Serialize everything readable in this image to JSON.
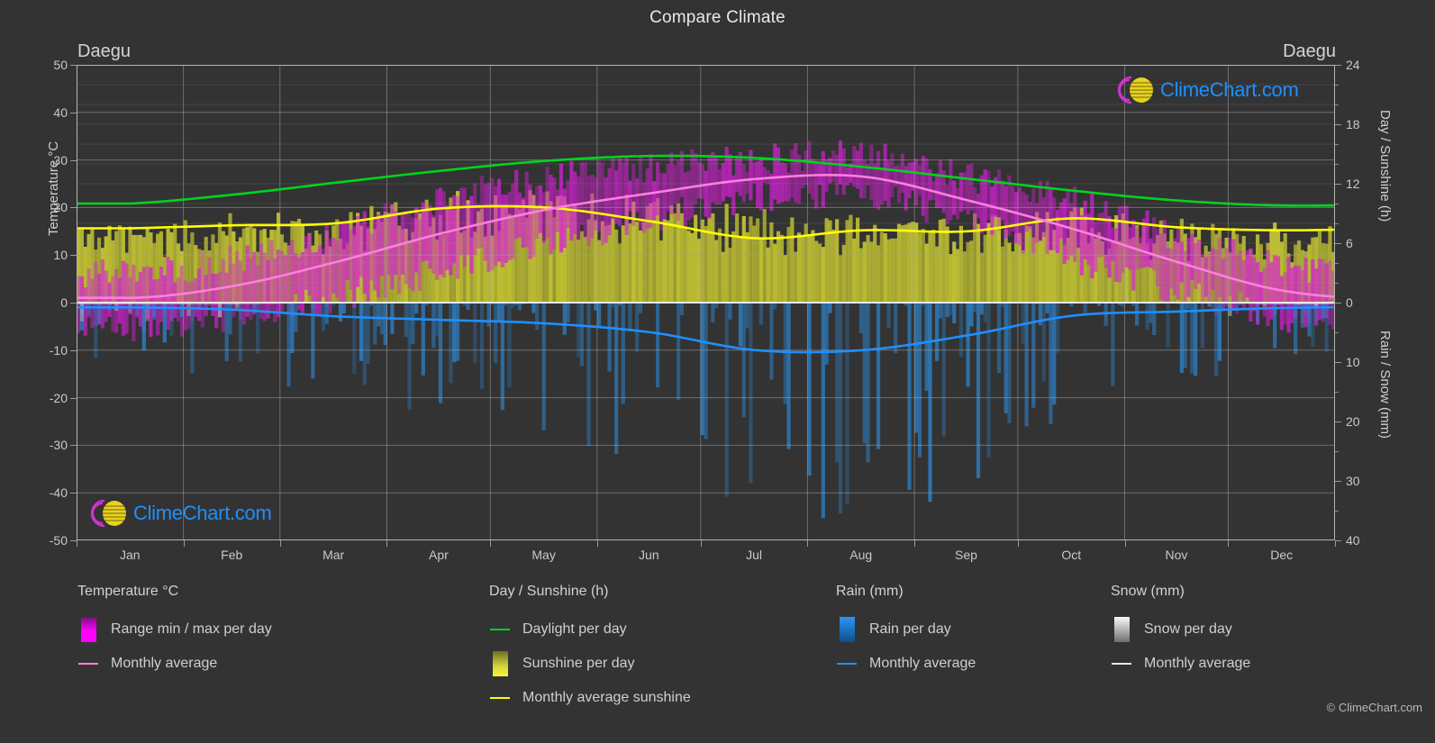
{
  "header": {
    "title": "Compare Climate",
    "city_left": "Daegu",
    "city_right": "Daegu"
  },
  "axes": {
    "y_left_label": "Temperature °C",
    "y_right_top_label": "Day / Sunshine (h)",
    "y_right_bottom_label": "Rain / Snow (mm)",
    "y_left_ticks": [
      "50",
      "40",
      "30",
      "20",
      "10",
      "0",
      "-10",
      "-20",
      "-30",
      "-40",
      "-50"
    ],
    "y_right_top_ticks": [
      "24",
      "18",
      "12",
      "6",
      "0"
    ],
    "y_right_bottom_ticks": [
      "0",
      "10",
      "20",
      "30",
      "40"
    ],
    "x_ticks": [
      "Jan",
      "Feb",
      "Mar",
      "Apr",
      "May",
      "Jun",
      "Jul",
      "Aug",
      "Sep",
      "Oct",
      "Nov",
      "Dec"
    ]
  },
  "legend": {
    "temperature": {
      "heading": "Temperature °C",
      "items": [
        {
          "label": "Range min / max per day",
          "key": "swatch",
          "color": "#ff00ff"
        },
        {
          "label": "Monthly average",
          "key": "line",
          "color": "#ff7fdf"
        }
      ]
    },
    "daysun": {
      "heading": "Day / Sunshine (h)",
      "items": [
        {
          "label": "Daylight per day",
          "key": "line",
          "color": "#00d41e"
        },
        {
          "label": "Sunshine per day",
          "key": "swatch",
          "color": "#f5f53c"
        },
        {
          "label": "Monthly average sunshine",
          "key": "line",
          "color": "#ffff00"
        }
      ]
    },
    "rain": {
      "heading": "Rain (mm)",
      "items": [
        {
          "label": "Rain per day",
          "key": "swatch",
          "color": "#1e90ff"
        },
        {
          "label": "Monthly average",
          "key": "line",
          "color": "#1e90ff"
        }
      ]
    },
    "snow": {
      "heading": "Snow (mm)",
      "items": [
        {
          "label": "Snow per day",
          "key": "swatch",
          "color": "#f2f2f2"
        },
        {
          "label": "Monthly average",
          "key": "line",
          "color": "#e8e8e8"
        }
      ]
    },
    "copyright": "© ClimeChart.com"
  },
  "watermark": {
    "text": "ClimeChart.com",
    "arc_color": "#cc33cc",
    "sphere_color": "#e8d21e",
    "text_color": "#1e90ff"
  },
  "chart_data": {
    "type": "line",
    "title": "Compare Climate",
    "subtitle": "Daegu",
    "xlabel": "",
    "ylabel": "Temperature °C",
    "ylim": [
      -50,
      50
    ],
    "y2lim_top": [
      0,
      24
    ],
    "y2lim_bottom": [
      0,
      40
    ],
    "grid": true,
    "legend_position": "bottom",
    "categories": [
      "Jan",
      "Feb",
      "Mar",
      "Apr",
      "May",
      "Jun",
      "Jul",
      "Aug",
      "Sep",
      "Oct",
      "Nov",
      "Dec"
    ],
    "series": [
      {
        "name": "Monthly average temperature",
        "axis": "left",
        "unit": "°C",
        "color": "#ff7fdf",
        "values": [
          1.0,
          3.5,
          8.5,
          14.5,
          19.5,
          23.0,
          26.0,
          26.5,
          21.5,
          15.5,
          8.5,
          2.5
        ]
      },
      {
        "name": "Daylight per day",
        "axis": "right_top",
        "unit": "h",
        "color": "#00d41e",
        "values": [
          10.0,
          10.9,
          12.1,
          13.3,
          14.3,
          14.8,
          14.6,
          13.7,
          12.5,
          11.3,
          10.3,
          9.8
        ]
      },
      {
        "name": "Monthly average sunshine",
        "axis": "right_top",
        "unit": "h",
        "color": "#ffff00",
        "values": [
          7.5,
          7.8,
          8.0,
          9.5,
          9.6,
          8.2,
          6.5,
          7.3,
          7.2,
          8.5,
          7.6,
          7.3
        ]
      },
      {
        "name": "Monthly average rain",
        "axis": "right_bottom",
        "unit": "mm",
        "color": "#1e90ff",
        "values": [
          0.8,
          1.2,
          2.3,
          2.9,
          3.5,
          5.0,
          8.0,
          8.0,
          5.5,
          2.2,
          1.5,
          0.9
        ]
      },
      {
        "name": "Monthly average snow",
        "axis": "right_bottom",
        "unit": "mm",
        "color": "#e8e8e8",
        "values": [
          0.1,
          0.1,
          0.0,
          0.0,
          0.0,
          0.0,
          0.0,
          0.0,
          0.0,
          0.0,
          0.0,
          0.1
        ]
      }
    ],
    "daily_bands": [
      {
        "name": "Range min / max per day",
        "axis": "left",
        "color": "#ff00ff",
        "min": [
          -5.0,
          -3.0,
          1.0,
          6.5,
          12.0,
          17.5,
          22.0,
          22.5,
          17.0,
          9.5,
          2.5,
          -3.0
        ],
        "max": [
          6.0,
          9.0,
          15.0,
          21.5,
          26.0,
          28.5,
          30.0,
          31.0,
          26.5,
          21.5,
          14.0,
          8.0
        ]
      },
      {
        "name": "Sunshine per day",
        "axis": "right_top",
        "color": "#c8c832",
        "min": [
          0,
          0,
          0,
          0,
          0,
          0,
          0,
          0,
          0,
          0,
          0,
          0
        ],
        "max": [
          8.5,
          9.0,
          9.5,
          11.0,
          11.5,
          11.0,
          9.5,
          9.5,
          9.0,
          9.5,
          8.5,
          8.0
        ]
      },
      {
        "name": "Rain per day",
        "axis": "right_bottom",
        "color": "#1e78c8",
        "max": [
          10,
          14,
          19,
          22,
          26,
          30,
          40,
          40,
          32,
          18,
          14,
          10
        ]
      }
    ]
  }
}
